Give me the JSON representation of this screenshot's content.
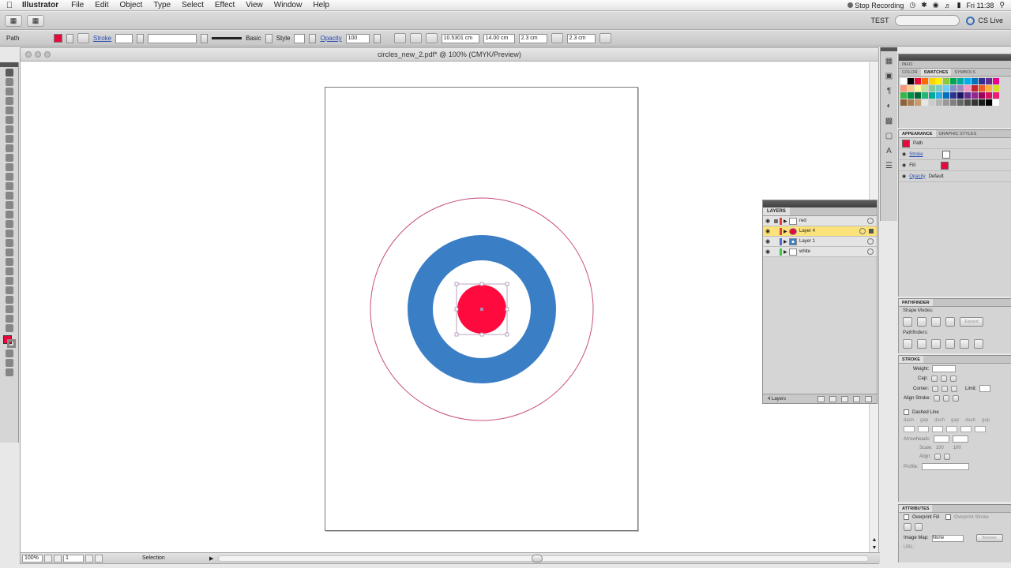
{
  "menubar": {
    "app_name": "Illustrator",
    "menus": [
      "File",
      "Edit",
      "Object",
      "Type",
      "Select",
      "Effect",
      "View",
      "Window",
      "Help"
    ],
    "stop_recording": "Stop Recording",
    "clock": "Fri 11:38"
  },
  "appbar": {
    "workspace": "TEST",
    "cs_live": "CS Live"
  },
  "controlbar": {
    "selection_type": "Path",
    "stroke_label": "Stroke",
    "brush_label": "Basic",
    "style_label": "Style",
    "opacity_label": "Opacity",
    "opacity_value": "100",
    "x_value": "10.5301 cm",
    "y_value": "14.00 cm",
    "w_value": "2.3 cm",
    "h_value": "2.3 cm"
  },
  "document": {
    "title": "circles_new_2.pdf* @ 100% (CMYK/Preview)",
    "zoom": "100%",
    "page": "1",
    "status": "Selection"
  },
  "artwork": {
    "outer_ring_color": "#c84d80",
    "blue_ring_color": "#3a7ec5",
    "center_color": "#ff0a3f",
    "selection_color": "#a88fb0"
  },
  "layers_panel": {
    "tab": "LAYERS",
    "layers": [
      {
        "name": "red",
        "color": "#e03c3c",
        "thumb": "plain",
        "selected": false
      },
      {
        "name": "Layer 4",
        "color": "#e03c3c",
        "thumb": "red",
        "selected": true
      },
      {
        "name": "Layer 1",
        "color": "#4a6ad8",
        "thumb": "blue",
        "selected": false
      },
      {
        "name": "white",
        "color": "#3fc83f",
        "thumb": "plain",
        "selected": false
      }
    ],
    "footer": "4 Layers"
  },
  "info_panel": {
    "tab": "INFO"
  },
  "swatches_panel": {
    "tabs": [
      "COLOR",
      "SWATCHES",
      "SYMBOLS"
    ],
    "active_tab": "SWATCHES",
    "colors": [
      "#ffffff",
      "#000000",
      "#e8093c",
      "#ff6a00",
      "#ffd200",
      "#fff200",
      "#8dc63f",
      "#00a651",
      "#00a99d",
      "#00aeef",
      "#0072bc",
      "#2e3192",
      "#662d91",
      "#ec008c",
      "#f7977a",
      "#fdc68a",
      "#fff799",
      "#c4df9b",
      "#82ca9c",
      "#7accc8",
      "#6dcff6",
      "#8393ca",
      "#a187be",
      "#f49ac2",
      "#c1272d",
      "#f15a24",
      "#fbb03b",
      "#d9e021",
      "#39b54a",
      "#009245",
      "#006837",
      "#22b573",
      "#00a99d",
      "#29abe2",
      "#0071bc",
      "#2e3192",
      "#1b1464",
      "#662d91",
      "#93278f",
      "#9e005d",
      "#d4145a",
      "#ed1e79",
      "#8c6239",
      "#a67c52",
      "#c69c6d",
      "#e6e6e6",
      "#cccccc",
      "#b3b3b3",
      "#999999",
      "#808080",
      "#666666",
      "#4d4d4d",
      "#333333",
      "#1a1a1a",
      "#000000",
      "#ffffff"
    ]
  },
  "appearance_panel": {
    "tabs": [
      "APPEARANCE",
      "GRAPHIC STYLES"
    ],
    "active_tab": "APPEARANCE",
    "object": "Path",
    "stroke_label": "Stroke",
    "fill_label": "Fill",
    "opacity_label": "Opacity",
    "opacity_value": "Default",
    "fill_color": "#e8093c"
  },
  "pathfinder_panel": {
    "tab": "PATHFINDER",
    "shape_modes": "Shape Modes:",
    "pathfinders": "Pathfinders:",
    "expand": "Expand"
  },
  "stroke_panel": {
    "tab": "STROKE",
    "weight": "Weight:",
    "cap": "Cap:",
    "corner": "Corner:",
    "limit": "Limit:",
    "align": "Align Stroke:",
    "dashed": "Dashed Line",
    "arrowheads": "Arrowheads:",
    "scale": "Scale:",
    "align2": "Align:",
    "profile": "Profile:",
    "dash_labels": [
      "dash",
      "gap",
      "dash",
      "gap",
      "dash",
      "gap"
    ],
    "scale_values": [
      "100",
      "100"
    ]
  },
  "attributes_panel": {
    "tab": "ATTRIBUTES",
    "overprint_fill": "Overprint Fill",
    "overprint_stroke": "Overprint Stroke",
    "image_map": "Image Map:",
    "image_map_value": "None",
    "browser": "Browser",
    "url": "URL:"
  }
}
